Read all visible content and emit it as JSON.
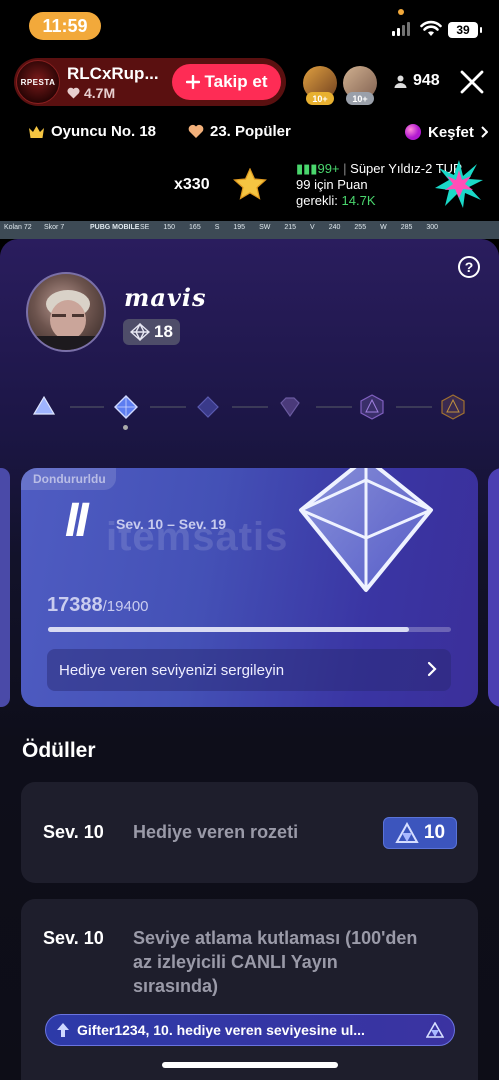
{
  "status_bar": {
    "time": "11:59",
    "battery": "39"
  },
  "live_header": {
    "host_name": "RLCxRup...",
    "host_avatar_text": "RPESTA",
    "host_likes": "4.7M",
    "follow_label": "Takip et",
    "viewer_badges": [
      "10+",
      "10+"
    ],
    "viewer_count": "948"
  },
  "info_row": {
    "player_no": "Oyuncu No. 18",
    "popular": "23. Popüler",
    "explore": "Keşfet"
  },
  "ranking": {
    "multiplier": "x330",
    "rank_change": "99+",
    "rank_label": "Süper Yıldız-2",
    "rank_suffix": "TUR",
    "points_needed_line1": "99 için Puan",
    "points_needed_line2_label": "gerekli:",
    "points_needed_value": "14.7K"
  },
  "game_strip": {
    "player_a": "Kolan",
    "player_a_val": "72",
    "player_b": "Skor",
    "player_b_val": "7",
    "logo": "PUBG MOBILE",
    "compass": [
      "SE",
      "150",
      "165",
      "S",
      "195",
      "SW",
      "215",
      "V",
      "240",
      "255",
      "W",
      "285",
      "300"
    ]
  },
  "panel": {
    "profile_name": "mavis",
    "profile_level": "18",
    "card": {
      "frozen_tag": "Dondururldu",
      "roman": "II",
      "range": "Sev. 10 – Sev. 19",
      "watermark": "itemsatis",
      "points_current": "17388",
      "points_max": "/19400",
      "progress_fraction": 0.896,
      "showcase_label": "Hediye veren seviyenizi sergileyin"
    },
    "rewards_title": "Ödüller",
    "rewards": [
      {
        "level": "Sev. 10",
        "text": "Hediye veren rozeti",
        "badge_value": "10"
      },
      {
        "level": "Sev. 10",
        "text_lines": [
          "Seviye atlama kutlaması (100'den",
          "az izleyicili CANLI Yayın",
          "sırasında)"
        ],
        "notice": "Gifter1234, 10. hediye veren seviyesine ul..."
      }
    ]
  },
  "colors": {
    "follow": "#fe2c55",
    "time_pill": "#f2a93b",
    "green": "#4ad66d",
    "badge_blue": "#3c55bd"
  },
  "icons": [
    "heart-icon",
    "plus-icon",
    "person-icon",
    "close-icon",
    "crown-icon",
    "heart-hand-icon",
    "orb-icon",
    "chevron-right-icon",
    "star-icon",
    "burst-icon",
    "help-icon",
    "diamond-icon",
    "crystal-icon"
  ]
}
